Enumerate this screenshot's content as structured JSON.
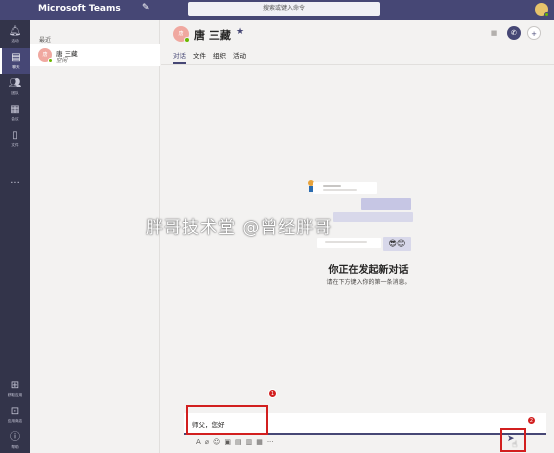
{
  "app": {
    "title": "Microsoft Teams"
  },
  "search": {
    "placeholder": "搜索或键入命令"
  },
  "rail": {
    "items": [
      {
        "label": "活动",
        "icon": "bell-icon"
      },
      {
        "label": "聊天",
        "icon": "chat-icon",
        "active": true
      },
      {
        "label": "团队",
        "icon": "teams-icon"
      },
      {
        "label": "会议",
        "icon": "calendar-icon"
      },
      {
        "label": "文件",
        "icon": "files-icon"
      }
    ],
    "more": "···",
    "bottom": [
      {
        "label": "获取应用",
        "icon": "get-apps-icon"
      },
      {
        "label": "应用商店",
        "icon": "store-icon"
      },
      {
        "label": "帮助",
        "icon": "help-icon"
      }
    ]
  },
  "chatlist": {
    "section": "最近",
    "items": [
      {
        "initials": "唐",
        "name": "唐 三藏",
        "status": "空闲"
      }
    ]
  },
  "main": {
    "avatar_initials": "唐",
    "name": "唐 三藏",
    "tabs": [
      "对话",
      "文件",
      "组织",
      "活动"
    ],
    "empty_title": "你正在发起新对话",
    "empty_subtitle": "请在下方键入你的第一条消息。"
  },
  "compose": {
    "message": "师父，您好"
  },
  "annotations": {
    "badge1": "1",
    "badge2": "2"
  },
  "watermark": "胖哥技术堂 @曾经胖哥",
  "colors": {
    "brand": "#464775",
    "highlight": "#d21f1f",
    "presence": "#6bb700"
  }
}
